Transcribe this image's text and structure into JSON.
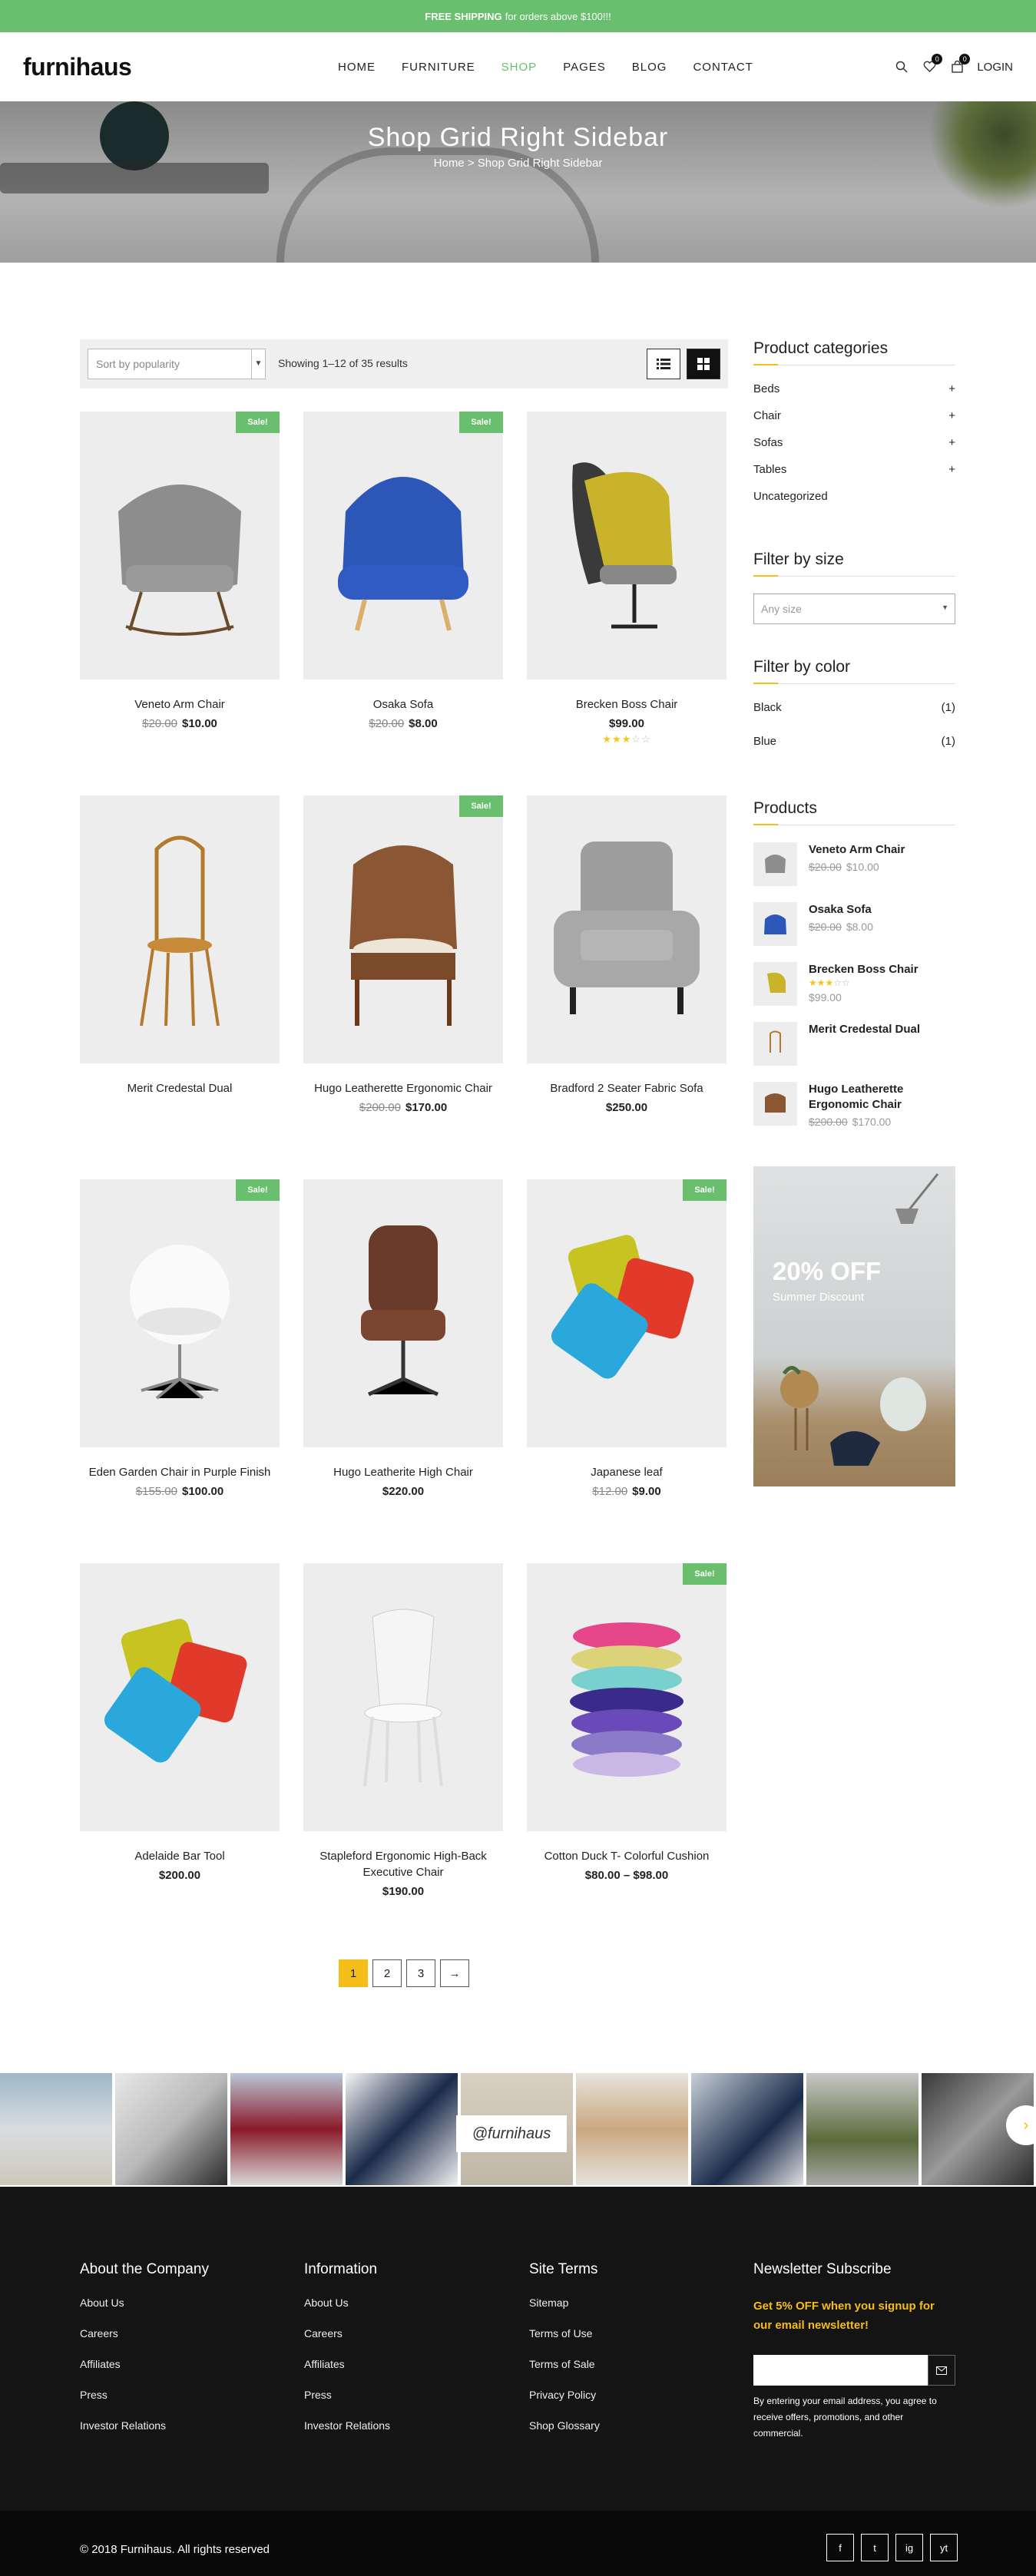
{
  "topbar": {
    "bold": "FREE SHIPPING",
    "rest": "for orders above $100!!!"
  },
  "header": {
    "logo": "furnihaus",
    "nav": [
      "HOME",
      "FURNITURE",
      "SHOP",
      "PAGES",
      "BLOG",
      "CONTACT"
    ],
    "active_nav": "SHOP",
    "wishlist_count": "0",
    "cart_count": "0",
    "login": "LOGIN"
  },
  "hero": {
    "title": "Shop Grid Right Sidebar",
    "crumb_home": "Home",
    "crumb_sep": ">",
    "crumb_current": "Shop Grid Right Sidebar"
  },
  "toolbar": {
    "sort": "Sort by popularity",
    "showing": "Showing 1–12 of 35 results"
  },
  "products": [
    {
      "name": "Veneto Arm Chair",
      "old": "$20.00",
      "price": "$10.00",
      "sale": "Sale!"
    },
    {
      "name": "Osaka Sofa",
      "old": "$20.00",
      "price": "$8.00",
      "sale": "Sale!"
    },
    {
      "name": "Brecken Boss Chair",
      "old": "",
      "price": "$99.00",
      "sale": "",
      "rating": 3
    },
    {
      "name": "Merit Credestal Dual",
      "old": "",
      "price": "",
      "sale": ""
    },
    {
      "name": "Hugo Leatherette Ergonomic Chair",
      "old": "$200.00",
      "price": "$170.00",
      "sale": "Sale!"
    },
    {
      "name": "Bradford 2 Seater Fabric Sofa",
      "old": "",
      "price": "$250.00",
      "sale": ""
    },
    {
      "name": "Eden Garden Chair in Purple Finish",
      "old": "$155.00",
      "price": "$100.00",
      "sale": "Sale!"
    },
    {
      "name": "Hugo Leatherite High Chair",
      "old": "",
      "price": "$220.00",
      "sale": ""
    },
    {
      "name": "Japanese leaf",
      "old": "$12.00",
      "price": "$9.00",
      "sale": "Sale!"
    },
    {
      "name": "Adelaide Bar Tool",
      "old": "",
      "price": "$200.00",
      "sale": ""
    },
    {
      "name": "Stapleford Ergonomic High-Back Executive Chair",
      "old": "",
      "price": "$190.00",
      "sale": ""
    },
    {
      "name": "Cotton Duck T- Colorful Cushion",
      "old": "",
      "price": "$80.00 – $98.00",
      "sale": "Sale!"
    }
  ],
  "pagination": [
    "1",
    "2",
    "3",
    "→"
  ],
  "sidebar": {
    "categories_title": "Product categories",
    "categories": [
      {
        "name": "Beds",
        "toggle": "+"
      },
      {
        "name": "Chair",
        "toggle": "+"
      },
      {
        "name": "Sofas",
        "toggle": "+"
      },
      {
        "name": "Tables",
        "toggle": "+"
      },
      {
        "name": "Uncategorized",
        "toggle": ""
      }
    ],
    "size_title": "Filter by size",
    "size_placeholder": "Any size",
    "color_title": "Filter by color",
    "colors": [
      {
        "name": "Black",
        "count": "(1)"
      },
      {
        "name": "Blue",
        "count": "(1)"
      }
    ],
    "products_title": "Products",
    "products": [
      {
        "name": "Veneto Arm Chair",
        "old": "$20.00",
        "price": "$10.00"
      },
      {
        "name": "Osaka Sofa",
        "old": "$20.00",
        "price": "$8.00"
      },
      {
        "name": "Brecken Boss Chair",
        "old": "",
        "price": "$99.00",
        "rating": 3
      },
      {
        "name": "Merit Credestal Dual",
        "old": "",
        "price": ""
      },
      {
        "name": "Hugo Leatherette Ergonomic Chair",
        "old": "$200.00",
        "price": "$170.00"
      }
    ],
    "banner_big": "20% OFF",
    "banner_small": "Summer Discount"
  },
  "instagram": {
    "handle": "@furnihaus",
    "arrow": "›"
  },
  "footer": {
    "columns": [
      {
        "title": "About the Company",
        "links": [
          "About Us",
          "Careers",
          "Affiliates",
          "Press",
          "Investor Relations"
        ]
      },
      {
        "title": "Information",
        "links": [
          "About Us",
          "Careers",
          "Affiliates",
          "Press",
          "Investor Relations"
        ]
      },
      {
        "title": "Site Terms",
        "links": [
          "Sitemap",
          "Terms of Use",
          "Terms of Sale",
          "Privacy Policy",
          "Shop Glossary"
        ]
      }
    ],
    "newsletter_title": "Newsletter Subscribe",
    "newsletter_promo": "Get 5% OFF when you signup for our email newsletter!",
    "newsletter_note": "By entering your email address, you agree to receive offers, promotions, and other commercial.",
    "copyright": "© 2018 Furnihaus. All rights reserved",
    "social": [
      "f",
      "t",
      "ig",
      "yt"
    ]
  },
  "colors": {
    "accent": "#6abf6e",
    "yellow": "#f5bd18",
    "dark": "#141414"
  }
}
